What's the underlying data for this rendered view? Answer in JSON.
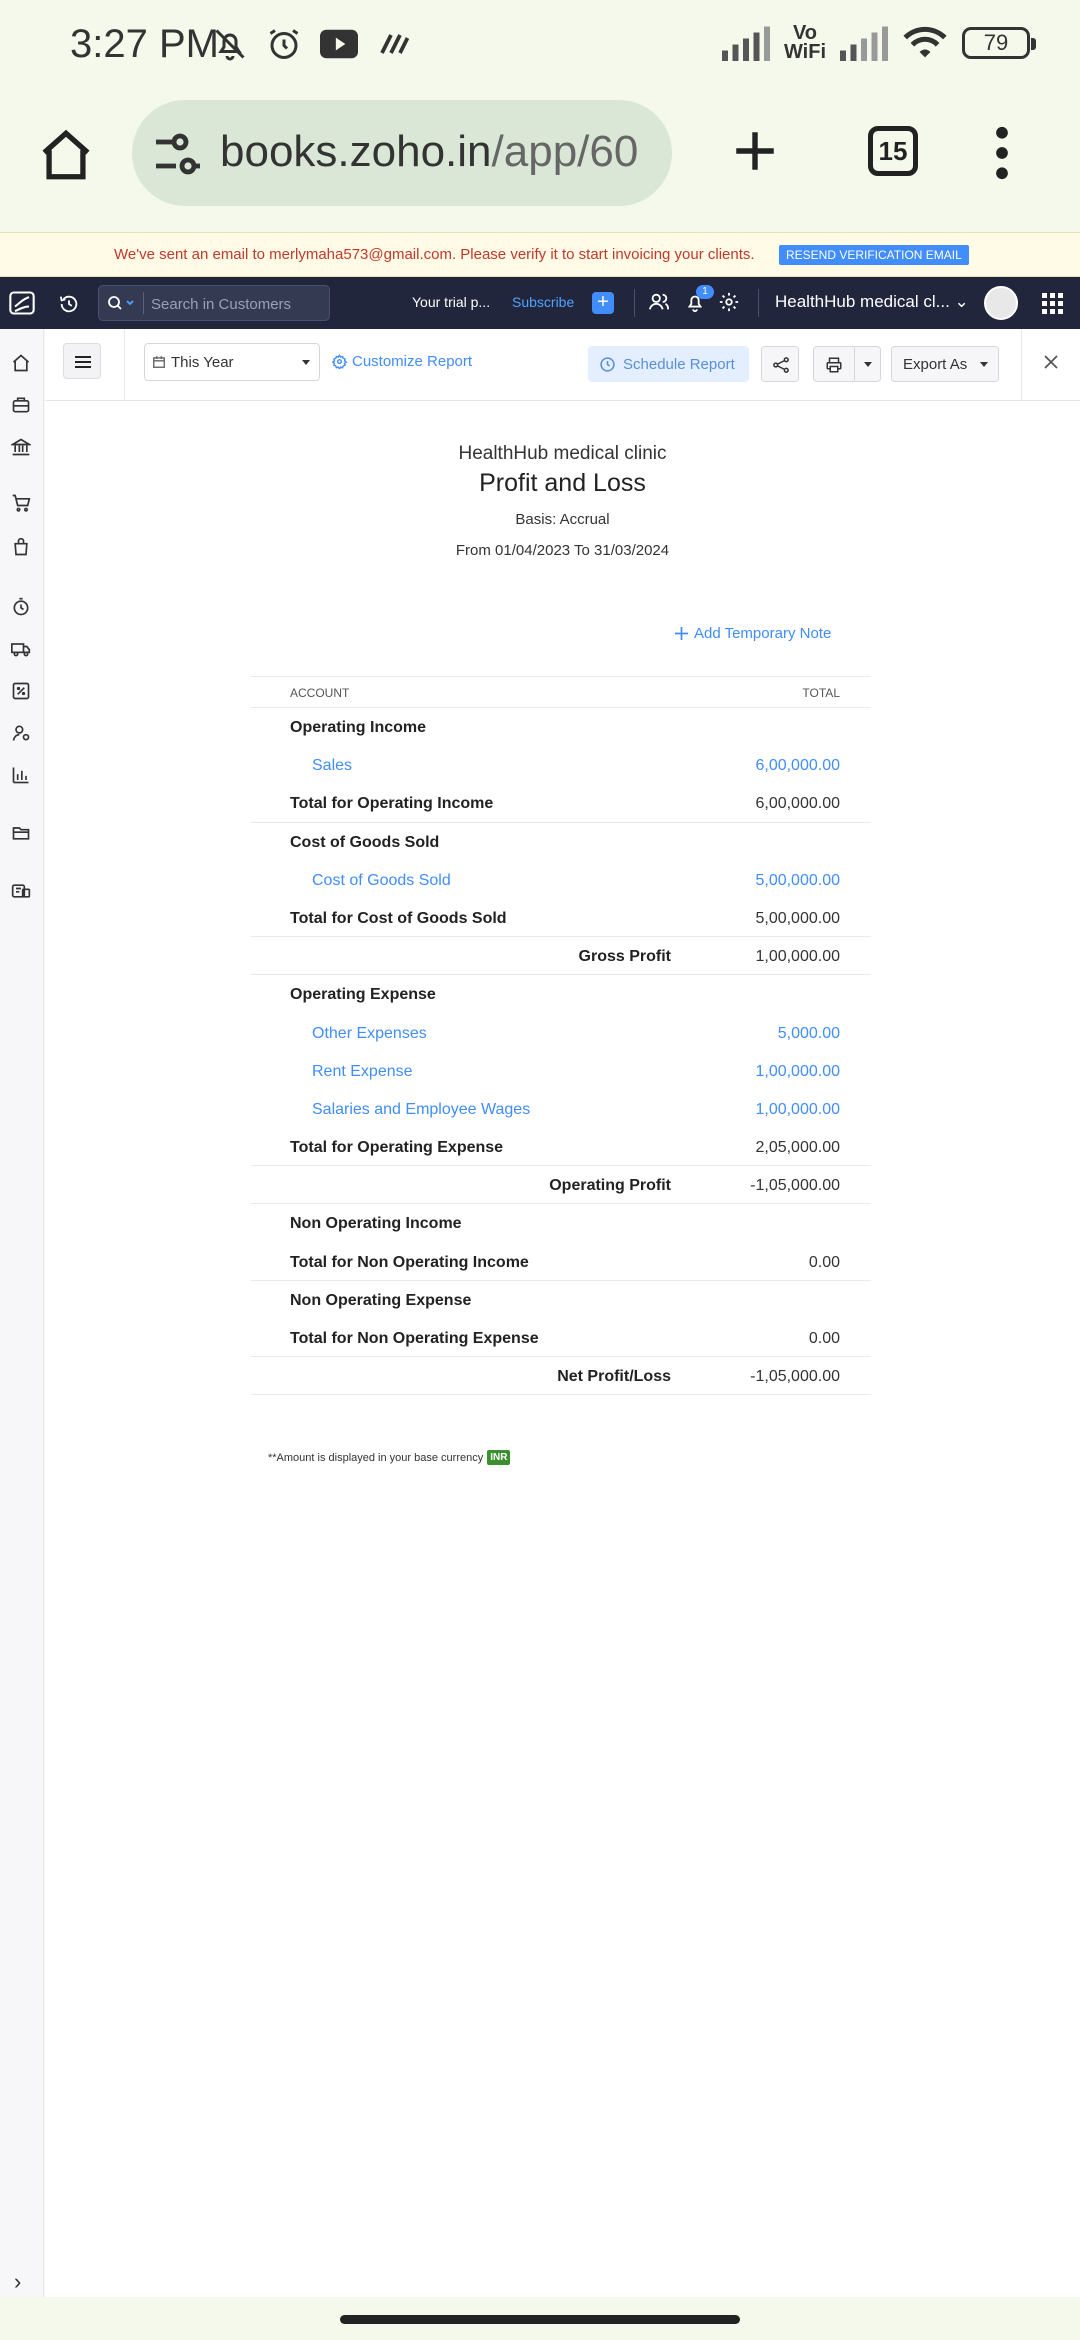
{
  "status_bar": {
    "time": "3:27 PM",
    "vowifi_top": "Vo",
    "vowifi_bottom": "WiFi",
    "battery": "79"
  },
  "browser": {
    "url_host": "books.zoho.in",
    "url_path": "/app/60",
    "tab_count": "15"
  },
  "banner": {
    "message": "We've sent an email to merlymaha573@gmail.com. Please verify it to start invoicing your clients.",
    "button": "RESEND VERIFICATION EMAIL"
  },
  "header": {
    "search_placeholder": "Search in Customers",
    "trial_text": "Your trial p...",
    "subscribe": "Subscribe",
    "notification_count": "1",
    "org_name": "HealthHub medical cl..."
  },
  "toolbar": {
    "period": "This Year",
    "customize": "Customize Report",
    "schedule": "Schedule Report",
    "export": "Export As"
  },
  "report": {
    "org": "HealthHub medical clinic",
    "title": "Profit and Loss",
    "basis": "Basis: Accrual",
    "range": "From 01/04/2023 To 31/03/2024",
    "add_note": "Add Temporary Note",
    "col_account": "ACCOUNT",
    "col_total": "TOTAL",
    "rows": {
      "op_income": "Operating Income",
      "sales": "Sales",
      "sales_amt": "6,00,000.00",
      "total_op_income": "Total for Operating Income",
      "total_op_income_amt": "6,00,000.00",
      "cogs_head": "Cost of Goods Sold",
      "cogs": "Cost of Goods Sold",
      "cogs_amt": "5,00,000.00",
      "total_cogs": "Total for Cost of Goods Sold",
      "total_cogs_amt": "5,00,000.00",
      "gross_profit": "Gross Profit",
      "gross_profit_amt": "1,00,000.00",
      "op_expense": "Operating Expense",
      "other_exp": "Other Expenses",
      "other_exp_amt": "5,000.00",
      "rent_exp": "Rent Expense",
      "rent_exp_amt": "1,00,000.00",
      "salaries": "Salaries and Employee Wages",
      "salaries_amt": "1,00,000.00",
      "total_op_expense": "Total for Operating Expense",
      "total_op_expense_amt": "2,05,000.00",
      "op_profit": "Operating Profit",
      "op_profit_amt": "-1,05,000.00",
      "non_op_income": "Non Operating Income",
      "total_non_op_income": "Total for Non Operating Income",
      "total_non_op_income_amt": "0.00",
      "non_op_expense": "Non Operating Expense",
      "total_non_op_expense": "Total for Non Operating Expense",
      "total_non_op_expense_amt": "0.00",
      "net": "Net Profit/Loss",
      "net_amt": "-1,05,000.00"
    },
    "footnote": "**Amount is displayed in your base currency",
    "currency": "INR"
  },
  "colors": {
    "accent": "#408dfb",
    "header_bg": "#21263c",
    "browser_bg": "#f5f9ec"
  }
}
